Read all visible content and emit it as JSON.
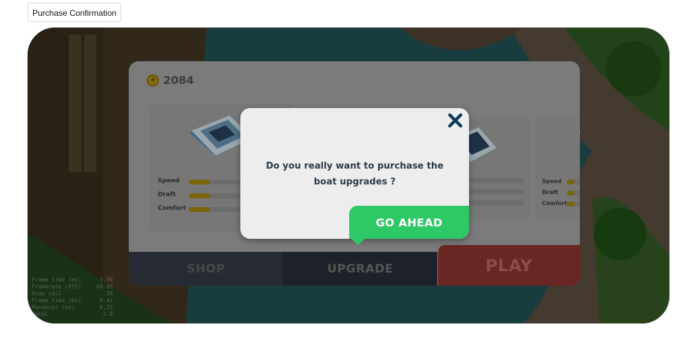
{
  "page": {
    "label": "Purchase Confirmation"
  },
  "hud": {
    "coins": "2084",
    "coin_icon": "coin-icon"
  },
  "debug": {
    "rows": [
      {
        "label": "Frame time (ms)",
        "value": "3.98"
      },
      {
        "label": "Framerate (FPS)",
        "value": "60.00"
      },
      {
        "label": "Draw call",
        "value": "38"
      },
      {
        "label": "Frame time (ms)",
        "value": "0.41"
      },
      {
        "label": "Renderer (ms)",
        "value": "0.25"
      },
      {
        "label": "WebGL",
        "value": "2.0"
      }
    ]
  },
  "boats": [
    {
      "stats": [
        {
          "label": "Speed",
          "level": 0.22
        },
        {
          "label": "Draft",
          "level": 0.22
        },
        {
          "label": "Comfort",
          "level": 0.22
        }
      ]
    },
    {
      "stats": [
        {
          "label": "Speed",
          "level": 0.0
        },
        {
          "label": "Draft",
          "level": 0.0
        },
        {
          "label": "Comfort",
          "level": 0.0
        }
      ]
    },
    {
      "stats": [
        {
          "label": "Speed",
          "level": 0.25
        },
        {
          "label": "Draft",
          "level": 0.25
        },
        {
          "label": "Comfort",
          "level": 0.25
        }
      ]
    }
  ],
  "tabs": {
    "shop": "SHOP",
    "upgrade": "UPGRADE",
    "play": "PLAY"
  },
  "dialog": {
    "message": "Do you really want to purchase the boat upgrades ?",
    "confirm_label": "GO AHEAD",
    "close_icon": "close-icon"
  },
  "colors": {
    "confirm": "#2ec866",
    "play": "#c0392b",
    "close": "#0d3b5e",
    "bar": "#f2c20f"
  }
}
